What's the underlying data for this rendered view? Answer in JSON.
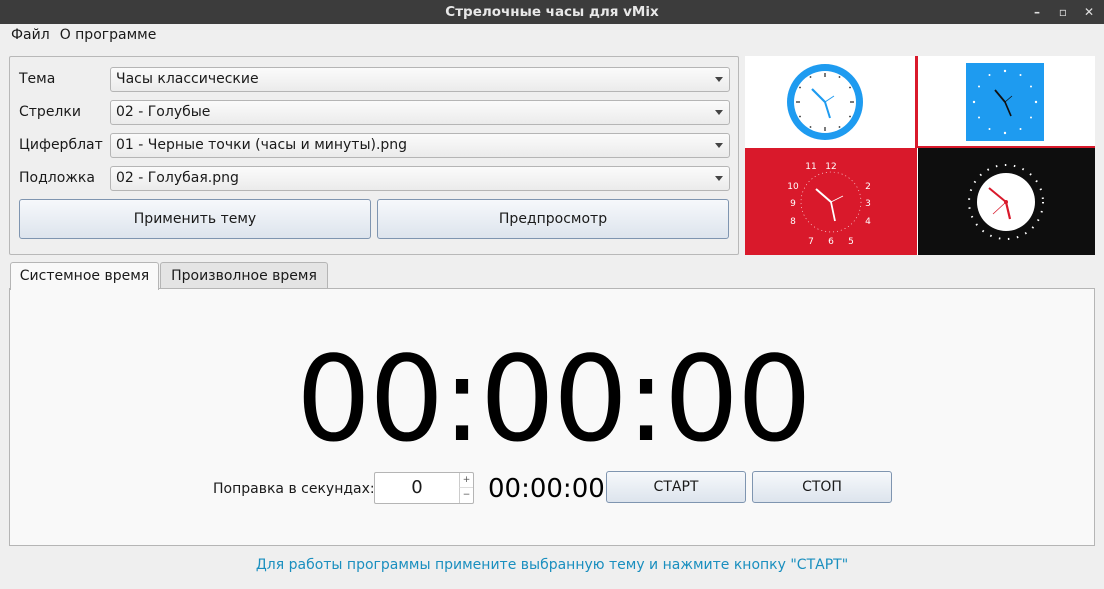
{
  "window": {
    "title": "Стрелочные часы для vMix"
  },
  "menu": {
    "file": "Файл",
    "about": "О программе"
  },
  "theme_group": {
    "rows": [
      {
        "label": "Тема",
        "value": "Часы классические"
      },
      {
        "label": "Стрелки",
        "value": "02 - Голубые"
      },
      {
        "label": "Циферблат",
        "value": "01 - Черные точки (часы и минуты).png"
      },
      {
        "label": "Подложка",
        "value": "02 - Голубая.png"
      }
    ],
    "apply_button": "Применить тему",
    "preview_button": "Предпросмотр"
  },
  "preview": {
    "red_numerals": [
      "12",
      "2",
      "3",
      "4",
      "5",
      "6",
      "7",
      "8",
      "9",
      "10",
      "11"
    ]
  },
  "tabs": [
    "Системное время",
    "Произволное время"
  ],
  "clock": {
    "main_time": "00:00:00",
    "correction_label": "Поправка в секундах:",
    "correction_value": "0",
    "spin_up": "+",
    "spin_down": "−",
    "small_time": "00:00:00",
    "start_button": "СТАРТ",
    "stop_button": "СТОП"
  },
  "status_text": "Для работы программы примените выбранную тему и нажмите кнопку \"СТАРТ\"",
  "colors": {
    "accent_blue": "#1e9bf0",
    "red_bg": "#d9192b",
    "black_bg": "#0e0e0e",
    "status_text": "#1a8fbf"
  }
}
